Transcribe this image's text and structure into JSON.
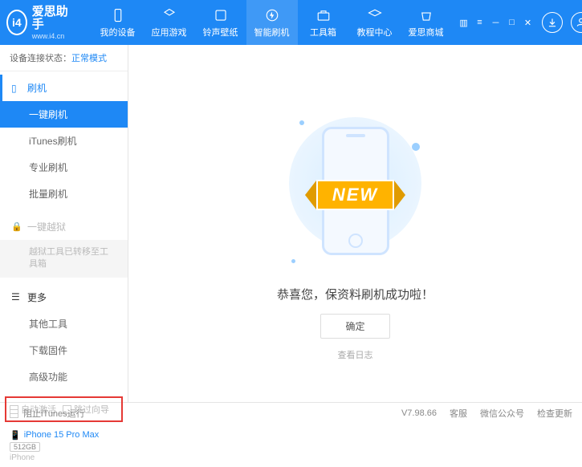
{
  "app": {
    "name": "爱思助手",
    "url": "www.i4.cn",
    "logo_letter": "i4"
  },
  "nav": [
    {
      "label": "我的设备",
      "icon": "device"
    },
    {
      "label": "应用游戏",
      "icon": "apps"
    },
    {
      "label": "铃声壁纸",
      "icon": "ringtone"
    },
    {
      "label": "智能刷机",
      "icon": "flash",
      "active": true
    },
    {
      "label": "工具箱",
      "icon": "toolbox"
    },
    {
      "label": "教程中心",
      "icon": "tutorial"
    },
    {
      "label": "爱思商城",
      "icon": "store"
    }
  ],
  "status": {
    "label": "设备连接状态：",
    "mode": "正常模式"
  },
  "sidebar": {
    "flash_header": "刷机",
    "flash_items": [
      "一键刷机",
      "iTunes刷机",
      "专业刷机",
      "批量刷机"
    ],
    "jailbreak_header": "一键越狱",
    "jailbreak_note": "越狱工具已转移至工具箱",
    "more_header": "更多",
    "more_items": [
      "其他工具",
      "下载固件",
      "高级功能"
    ],
    "auto_activate": "自动激活",
    "skip_guide": "跳过向导"
  },
  "device": {
    "name": "iPhone 15 Pro Max",
    "storage": "512GB",
    "type": "iPhone"
  },
  "main": {
    "ribbon": "NEW",
    "success_msg": "恭喜您，保资料刷机成功啦！",
    "confirm": "确定",
    "view_log": "查看日志"
  },
  "footer": {
    "block_itunes": "阻止iTunes运行",
    "version": "V7.98.66",
    "links": [
      "客服",
      "微信公众号",
      "检查更新"
    ]
  }
}
